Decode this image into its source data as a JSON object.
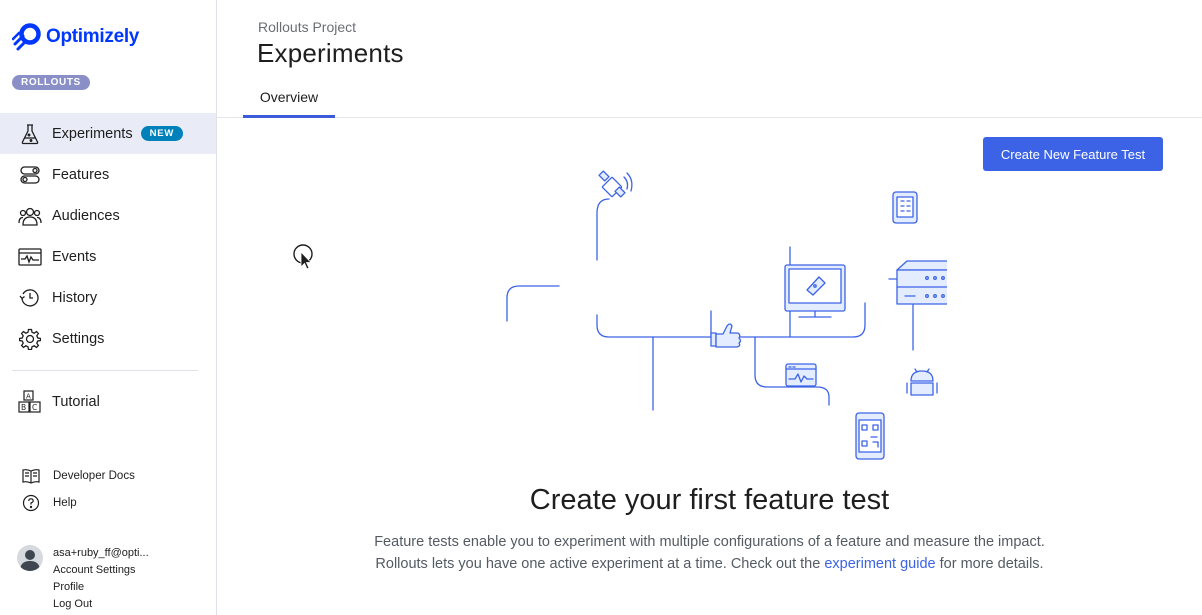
{
  "app": {
    "name": "Optimizely",
    "product_badge": "ROLLOUTS"
  },
  "sidebar": {
    "items": [
      {
        "label": "Experiments",
        "icon": "flask-icon",
        "active": true,
        "badge": "NEW"
      },
      {
        "label": "Features",
        "icon": "toggle-icon"
      },
      {
        "label": "Audiences",
        "icon": "people-icon"
      },
      {
        "label": "Events",
        "icon": "pulse-icon"
      },
      {
        "label": "History",
        "icon": "history-icon"
      },
      {
        "label": "Settings",
        "icon": "gear-icon"
      }
    ],
    "tutorial": {
      "label": "Tutorial",
      "icon": "abc-blocks-icon"
    },
    "footer": [
      {
        "label": "Developer Docs",
        "icon": "book-icon"
      },
      {
        "label": "Help",
        "icon": "question-icon"
      }
    ],
    "account": {
      "email": "asa+ruby_ff@opti...",
      "links": [
        "Account Settings",
        "Profile",
        "Log Out"
      ]
    }
  },
  "header": {
    "project": "Rollouts Project",
    "title": "Experiments",
    "tabs": [
      {
        "label": "Overview",
        "active": true
      }
    ]
  },
  "main": {
    "create_button": "Create New Feature Test",
    "empty_title": "Create your first feature test",
    "empty_line1": "Feature tests enable you to experiment with multiple configurations of a feature and measure the impact.",
    "empty_line2_pre": "Rollouts lets you have one active experiment at a time. Check out the",
    "empty_link": "experiment guide",
    "empty_line2_post": "for more details."
  },
  "colors": {
    "brand": "#0037ff",
    "accent": "#3c63e6",
    "illustration": "#3c63e6",
    "illustration_fill": "#e4ecff",
    "active_nav": "#e9ecf7"
  }
}
